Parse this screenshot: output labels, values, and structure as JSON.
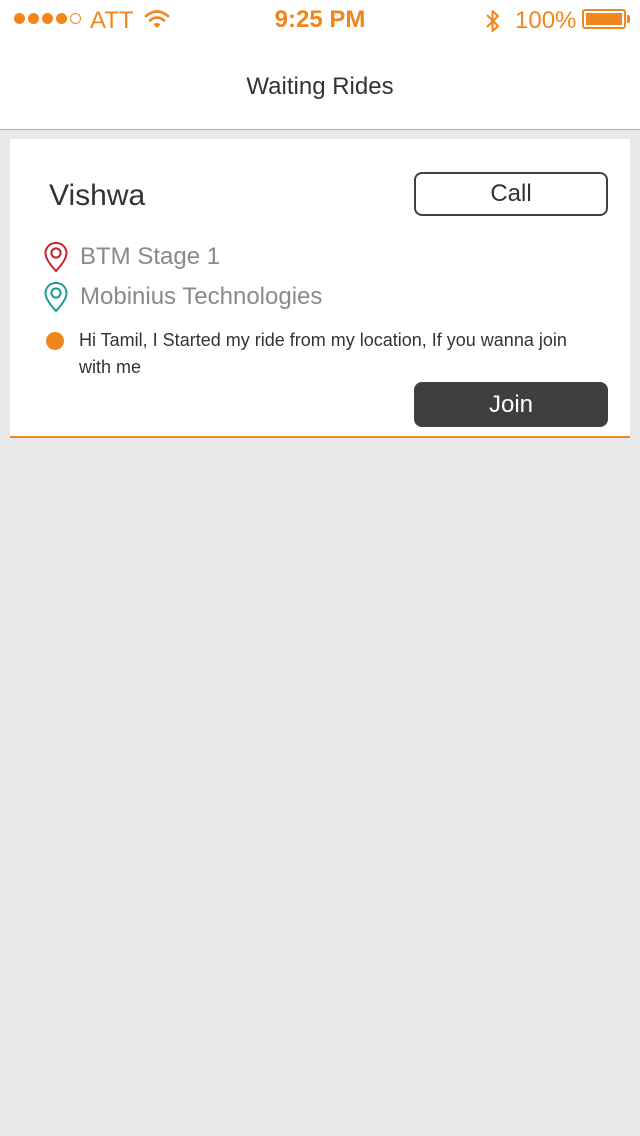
{
  "status_bar": {
    "carrier": "ATT",
    "time": "9:25 PM",
    "battery_percent": "100%",
    "signal_bars_filled": 4,
    "signal_bars_total": 5,
    "battery_level": 1.0,
    "accent_color": "#f0861e"
  },
  "nav": {
    "title": "Waiting Rides"
  },
  "ride_card": {
    "rider_name": "Vishwa",
    "call_label": "Call",
    "from_location": "BTM Stage 1",
    "to_location": "Mobinius Technologies",
    "message": "Hi Tamil, I Started my ride from my location, If you wanna join with me",
    "join_label": "Join",
    "from_pin_icon": "map-pin-red-icon",
    "to_pin_icon": "map-pin-teal-icon",
    "from_pin_color": "#c8232c",
    "to_pin_color": "#1a9e90"
  }
}
